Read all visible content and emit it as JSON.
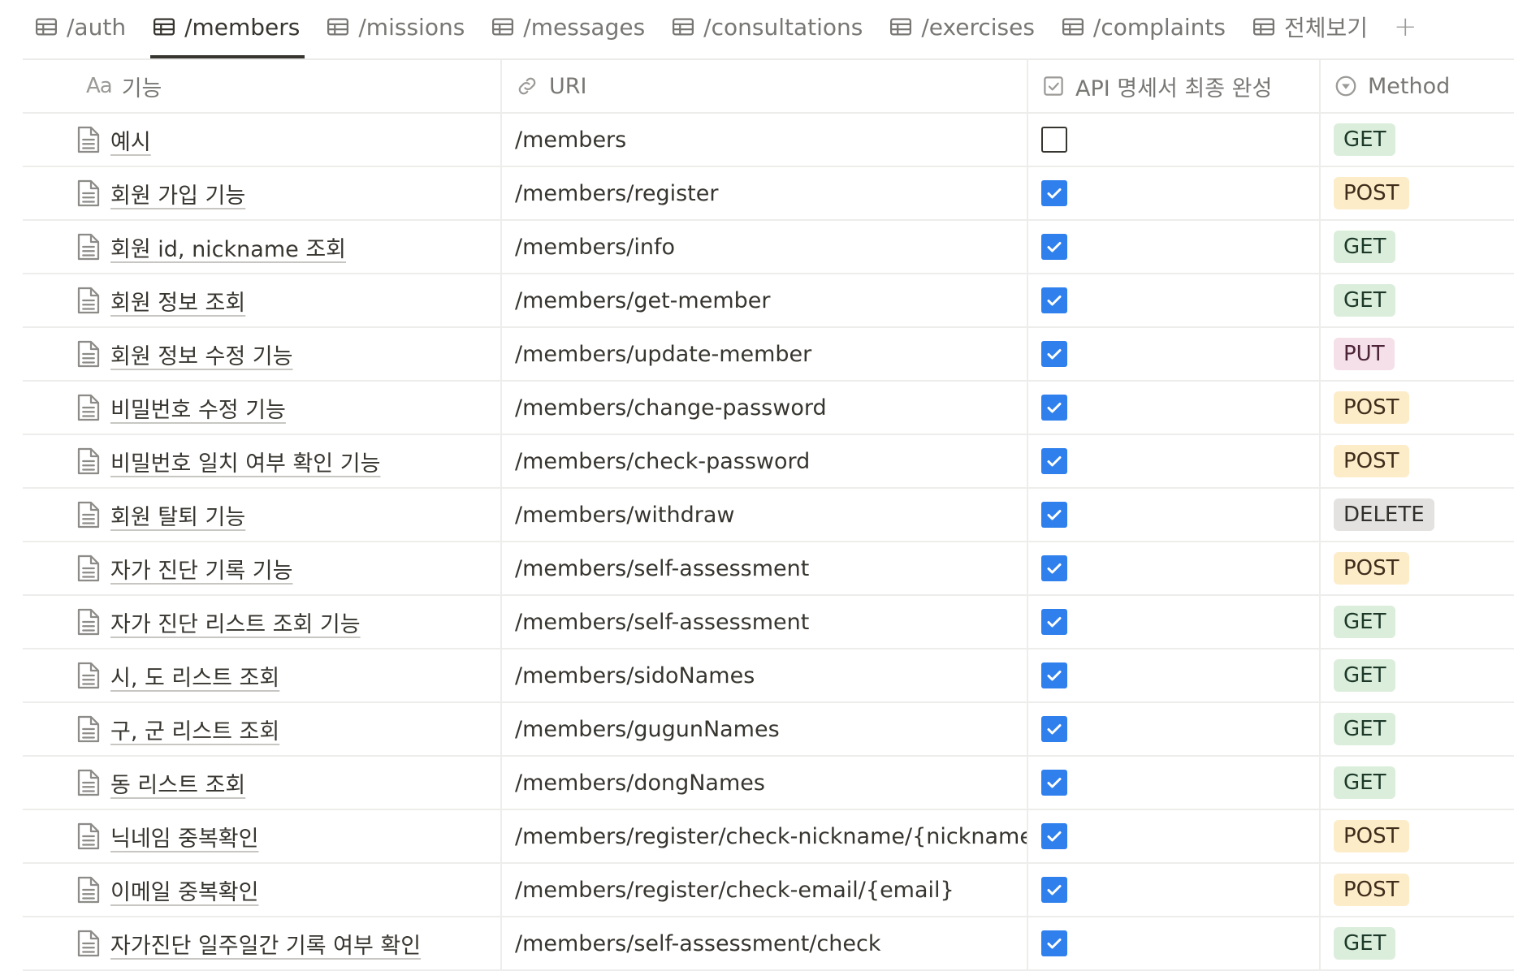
{
  "tabs": [
    {
      "label": "/auth",
      "icon": "table-icon",
      "active": false
    },
    {
      "label": "/members",
      "icon": "table-icon",
      "active": true
    },
    {
      "label": "/missions",
      "icon": "table-icon",
      "active": false
    },
    {
      "label": "/messages",
      "icon": "table-icon",
      "active": false
    },
    {
      "label": "/consultations",
      "icon": "table-icon",
      "active": false
    },
    {
      "label": "/exercises",
      "icon": "table-icon",
      "active": false
    },
    {
      "label": "/complaints",
      "icon": "table-icon",
      "active": false
    },
    {
      "label": "전체보기",
      "icon": "table-icon",
      "active": false
    }
  ],
  "add_tab_label": "+",
  "columns": {
    "name": {
      "prefix": "Aa",
      "label": "기능"
    },
    "uri": {
      "label": "URI",
      "icon": "link-icon"
    },
    "done": {
      "label": "API 명세서 최종 완성",
      "icon": "checkbox-icon"
    },
    "method": {
      "label": "Method",
      "icon": "select-icon"
    }
  },
  "method_colors": {
    "GET": "#dbeddb",
    "POST": "#fdecc8",
    "PUT": "#f5e0e9",
    "DELETE": "#e3e2e0"
  },
  "rows": [
    {
      "name": "예시",
      "uri": "/members",
      "done": false,
      "method": "GET"
    },
    {
      "name": "회원 가입 기능",
      "uri": "/members/register",
      "done": true,
      "method": "POST"
    },
    {
      "name": "회원 id, nickname 조회",
      "uri": "/members/info",
      "done": true,
      "method": "GET"
    },
    {
      "name": "회원 정보 조회",
      "uri": "/members/get-member",
      "done": true,
      "method": "GET"
    },
    {
      "name": "회원 정보 수정 기능",
      "uri": "/members/update-member",
      "done": true,
      "method": "PUT"
    },
    {
      "name": "비밀번호 수정 기능",
      "uri": "/members/change-password",
      "done": true,
      "method": "POST"
    },
    {
      "name": "비밀번호 일치 여부 확인 기능",
      "uri": "/members/check-password",
      "done": true,
      "method": "POST"
    },
    {
      "name": "회원 탈퇴 기능",
      "uri": "/members/withdraw",
      "done": true,
      "method": "DELETE"
    },
    {
      "name": "자가 진단 기록 기능",
      "uri": "/members/self-assessment",
      "done": true,
      "method": "POST"
    },
    {
      "name": "자가 진단 리스트 조회 기능",
      "uri": "/members/self-assessment",
      "done": true,
      "method": "GET"
    },
    {
      "name": "시, 도 리스트 조회",
      "uri": "/members/sidoNames",
      "done": true,
      "method": "GET"
    },
    {
      "name": "구, 군 리스트 조회",
      "uri": "/members/gugunNames",
      "done": true,
      "method": "GET"
    },
    {
      "name": "동 리스트 조회",
      "uri": "/members/dongNames",
      "done": true,
      "method": "GET"
    },
    {
      "name": "닉네임 중복확인",
      "uri": "/members/register/check-nickname/{nickname}",
      "done": true,
      "method": "POST"
    },
    {
      "name": "이메일 중복확인",
      "uri": "/members/register/check-email/{email}",
      "done": true,
      "method": "POST"
    },
    {
      "name": "자가진단 일주일간 기록 여부 확인",
      "uri": "/members/self-assessment/check",
      "done": true,
      "method": "GET"
    }
  ]
}
